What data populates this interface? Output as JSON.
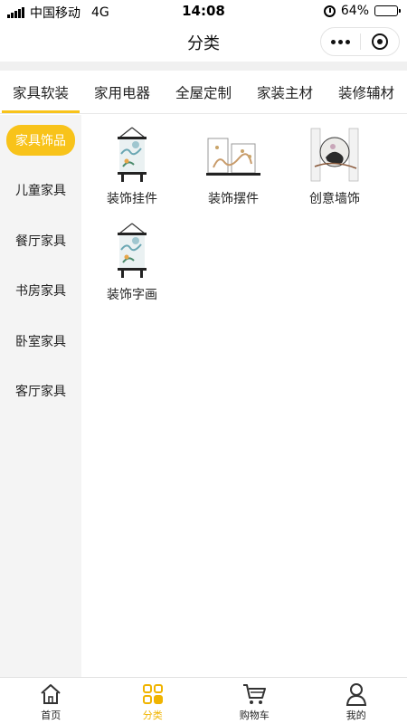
{
  "status_bar": {
    "carrier": "中国移动",
    "network": "4G",
    "time": "14:08",
    "battery": "64%",
    "battery_level": 0.64,
    "icons": [
      "signal-icon",
      "alarm-icon",
      "battery-icon"
    ]
  },
  "header": {
    "title": "分类",
    "menu_icon": "more-dots-icon",
    "close_icon": "target-close-icon"
  },
  "top_tabs": [
    {
      "label": "家具软装",
      "active": true
    },
    {
      "label": "家用电器",
      "active": false
    },
    {
      "label": "全屋定制",
      "active": false
    },
    {
      "label": "家装主材",
      "active": false
    },
    {
      "label": "装修辅材",
      "active": false
    }
  ],
  "sidebar": {
    "items": [
      {
        "label": "家具饰品",
        "active": true
      },
      {
        "label": "儿童家具",
        "active": false
      },
      {
        "label": "餐厅家具",
        "active": false
      },
      {
        "label": "书房家具",
        "active": false
      },
      {
        "label": "卧室家具",
        "active": false
      },
      {
        "label": "客厅家具",
        "active": false
      }
    ]
  },
  "products": [
    {
      "label": "装饰挂件",
      "icon": "hanging-scroll-icon"
    },
    {
      "label": "装饰摆件",
      "icon": "ornament-frames-icon"
    },
    {
      "label": "创意墙饰",
      "icon": "wall-art-icon"
    },
    {
      "label": "装饰字画",
      "icon": "hanging-scroll-icon"
    }
  ],
  "bottom_nav": [
    {
      "label": "首页",
      "icon": "home-icon",
      "active": false
    },
    {
      "label": "分类",
      "icon": "category-grid-icon",
      "active": true
    },
    {
      "label": "购物车",
      "icon": "cart-icon",
      "active": false
    },
    {
      "label": "我的",
      "icon": "user-icon",
      "active": false
    }
  ],
  "colors": {
    "accent": "#f8c31a",
    "sidebar_bg": "#f4f4f4",
    "active_nav": "#f0b400"
  }
}
